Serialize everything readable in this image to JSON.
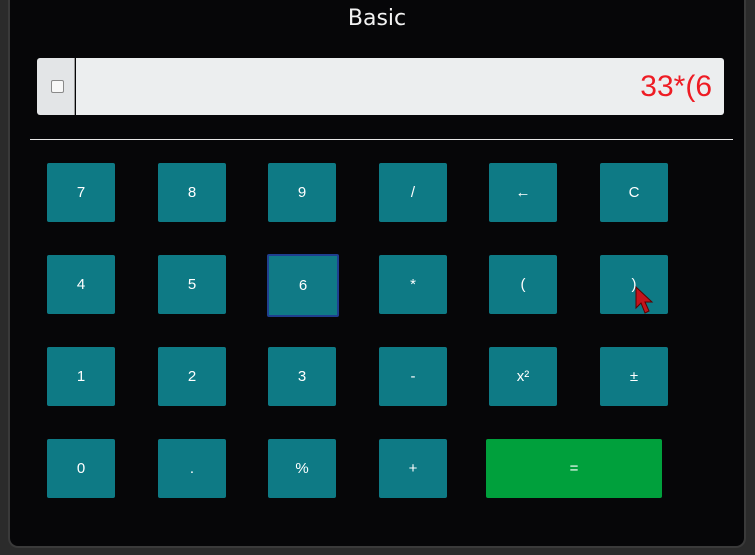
{
  "window": {
    "title": "Basic"
  },
  "display": {
    "value": "33*(6",
    "text_color": "#ee1c24",
    "checkbox_checked": false
  },
  "keys": {
    "k7": "7",
    "k8": "8",
    "k9": "9",
    "divide": "/",
    "backspace": "←",
    "clear": "C",
    "k4": "4",
    "k5": "5",
    "k6": "6",
    "multiply": "*",
    "lparen": "(",
    "rparen": ")",
    "k1": "1",
    "k2": "2",
    "k3": "3",
    "minus": "-",
    "square": "x²",
    "plusminus": "±",
    "k0": "0",
    "dot": ".",
    "percent": "%",
    "plus": "+",
    "equals": "="
  },
  "colors": {
    "key": "#0e7a85",
    "equals": "#00a03c",
    "focus_border": "#1f3f8f",
    "background": "#060608"
  },
  "focused_key": "6"
}
